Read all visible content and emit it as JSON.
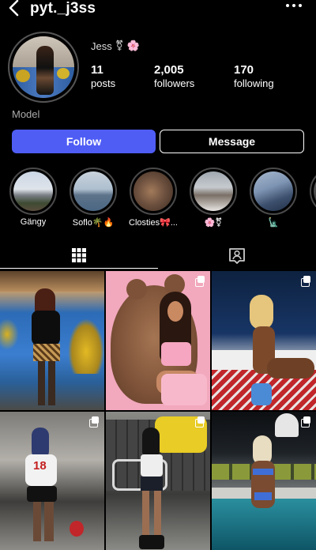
{
  "header": {
    "username": "pyt._j3ss"
  },
  "profile": {
    "display_name": "Jess",
    "name_emoji": "🌸",
    "gender_symbol": "⚧",
    "category": "Model",
    "stats": {
      "posts_count": "11",
      "posts_label": "posts",
      "followers_count": "2,005",
      "followers_label": "followers",
      "following_count": "170",
      "following_label": "following"
    }
  },
  "actions": {
    "follow_label": "Follow",
    "message_label": "Message"
  },
  "highlights": [
    {
      "label": "Gängy"
    },
    {
      "label": "Soflo🌴🔥"
    },
    {
      "label": "Closties🎀..."
    },
    {
      "label": "🌸⚧"
    },
    {
      "label": "🗽"
    },
    {
      "label": ""
    }
  ],
  "tabs": {
    "grid_icon": "grid-icon",
    "tagged_icon": "tagged-person-icon"
  },
  "posts": [
    {
      "type": "single"
    },
    {
      "type": "multi"
    },
    {
      "type": "multi"
    },
    {
      "type": "multi"
    },
    {
      "type": "multi"
    },
    {
      "type": "multi"
    }
  ],
  "colors": {
    "follow_button": "#4f5df5",
    "background": "#000000",
    "text": "#ffffff",
    "secondary_text": "#aaaaaa"
  }
}
